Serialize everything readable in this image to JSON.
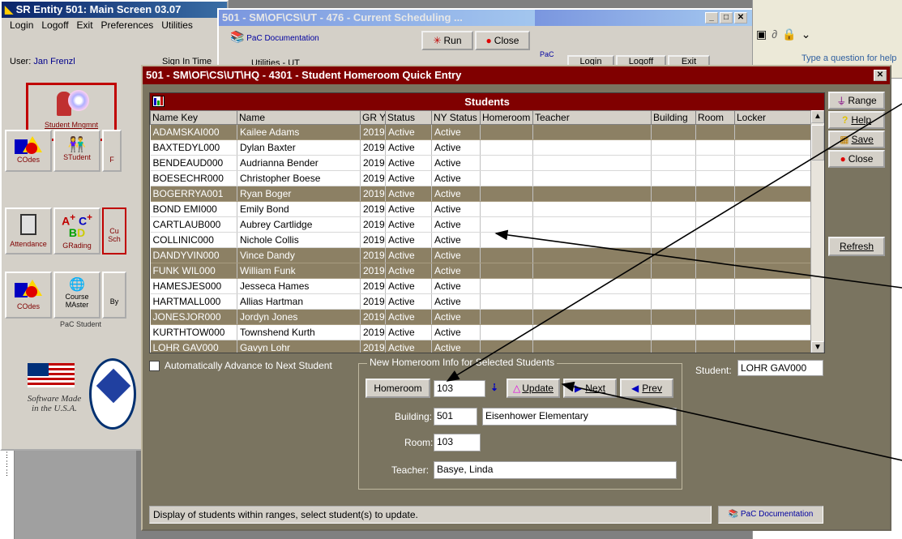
{
  "bg_window": {
    "title": "SR Entity 501: Main Screen 03.07",
    "menu": [
      "Login",
      "Logoff",
      "Exit",
      "Preferences",
      "Utilities"
    ],
    "user_label": "User:",
    "user_name": "Jan Frenzl",
    "sign_partial": "Sign In Time",
    "tiles": {
      "student_mngmnt": "Student Mngmnt",
      "codes": "COdes",
      "student": "STudent",
      "f_partial": "F",
      "attendance": "Attendance",
      "grading": "GRading",
      "cu_partial": "Cu",
      "sch_partial": "Sch",
      "codes2": "COdes",
      "course_master": "Course MAster",
      "by_partial": "By"
    },
    "flag_caption_1": "Software Made",
    "flag_caption_2": "in the U.S.A.",
    "pac_student": "PaC Student"
  },
  "sched_window": {
    "title": "501 - SM\\OF\\CS\\UT - 476 - Current Scheduling ...",
    "run_label": "Run",
    "close_label": "Close",
    "pac_doc": "PaC Documentation",
    "utilities_partial": "Utilities - UT",
    "pac_small": "PaC",
    "login": "Login",
    "logoff": "Logoff",
    "exit": "Exit"
  },
  "word_window": {
    "question_placeholder": "Type a question for help"
  },
  "dialog": {
    "title": "501 - SM\\OF\\CS\\UT\\HQ - 4301 - Student Homeroom Quick Entry",
    "grid_title": "Students",
    "columns": [
      "Name Key",
      "Name",
      "GR YR",
      "Status",
      "NY Status",
      "Homeroom",
      "Teacher",
      "Building",
      "Room",
      "Locker"
    ],
    "rows": [
      {
        "key": "ADAMSKAI000",
        "name": "Kailee Adams",
        "yr": "2019",
        "status": "Active",
        "ny": "Active",
        "selected": true
      },
      {
        "key": "BAXTEDYL000",
        "name": "Dylan Baxter",
        "yr": "2019",
        "status": "Active",
        "ny": "Active",
        "selected": false
      },
      {
        "key": "BENDEAUD000",
        "name": "Audrianna Bender",
        "yr": "2019",
        "status": "Active",
        "ny": "Active",
        "selected": false
      },
      {
        "key": "BOESECHR000",
        "name": "Christopher Boese",
        "yr": "2019",
        "status": "Active",
        "ny": "Active",
        "selected": false
      },
      {
        "key": "BOGERRYA001",
        "name": "Ryan Boger",
        "yr": "2019",
        "status": "Active",
        "ny": "Active",
        "selected": true
      },
      {
        "key": "BOND EMI000",
        "name": "Emily Bond",
        "yr": "2019",
        "status": "Active",
        "ny": "Active",
        "selected": false
      },
      {
        "key": "CARTLAUB000",
        "name": "Aubrey Cartlidge",
        "yr": "2019",
        "status": "Active",
        "ny": "Active",
        "selected": false
      },
      {
        "key": "COLLINIC000",
        "name": "Nichole Collis",
        "yr": "2019",
        "status": "Active",
        "ny": "Active",
        "selected": false
      },
      {
        "key": "DANDYVIN000",
        "name": "Vince Dandy",
        "yr": "2019",
        "status": "Active",
        "ny": "Active",
        "selected": true
      },
      {
        "key": "FUNK WIL000",
        "name": "William Funk",
        "yr": "2019",
        "status": "Active",
        "ny": "Active",
        "selected": true
      },
      {
        "key": "HAMESJES000",
        "name": "Jesseca Hames",
        "yr": "2019",
        "status": "Active",
        "ny": "Active",
        "selected": false
      },
      {
        "key": "HARTMALL000",
        "name": "Allias Hartman",
        "yr": "2019",
        "status": "Active",
        "ny": "Active",
        "selected": false
      },
      {
        "key": "JONESJOR000",
        "name": "Jordyn Jones",
        "yr": "2019",
        "status": "Active",
        "ny": "Active",
        "selected": true
      },
      {
        "key": "KURTHTOW000",
        "name": "Townshend Kurth",
        "yr": "2019",
        "status": "Active",
        "ny": "Active",
        "selected": false
      },
      {
        "key": "LOHR GAV000",
        "name": "Gavyn Lohr",
        "yr": "2019",
        "status": "Active",
        "ny": "Active",
        "selected": true
      }
    ],
    "side_buttons": {
      "range": "Range",
      "help": "Help",
      "save": "Save",
      "close": "Close",
      "refresh": "Refresh"
    },
    "auto_advance_label": "Automatically Advance to Next Student",
    "auto_advance_checked": false,
    "group_label": "New Homeroom Info for Selected Students",
    "homeroom_button": "Homeroom",
    "homeroom_value": "103",
    "update_button": "Update",
    "next_button": "Next",
    "prev_button": "Prev",
    "student_label": "Student:",
    "student_value": "LOHR GAV000",
    "building_label": "Building:",
    "building_code": "501",
    "building_name": "Eisenhower Elementary",
    "room_label": "Room:",
    "room_value": "103",
    "teacher_label": "Teacher:",
    "teacher_value": "Basye, Linda",
    "status_text": "Display of students within ranges, select student(s) to update.",
    "pac_doc": "PaC Documentation"
  },
  "colors": {
    "dialog_bg": "#7a7460",
    "dialog_title": "#800000",
    "selected_row": "#8c8064",
    "win_gray": "#d4d0c8"
  }
}
